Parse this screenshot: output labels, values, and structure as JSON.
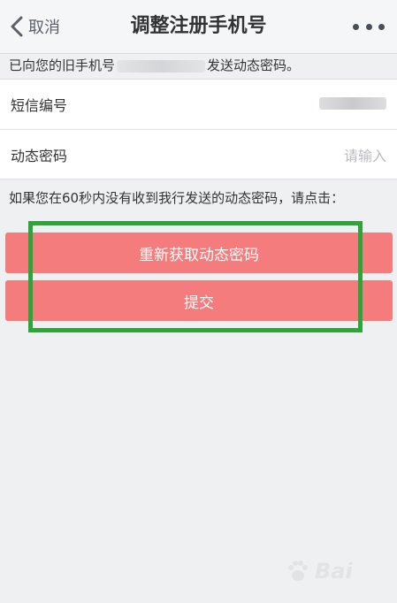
{
  "header": {
    "back_label": "取消",
    "title": "调整注册手机号"
  },
  "notice": {
    "prefix": "已向您的旧手机号",
    "suffix": "发送动态密码。"
  },
  "form": {
    "sms_label": "短信编号",
    "otp_label": "动态密码",
    "otp_placeholder": "请输入"
  },
  "hint": "如果您在60秒内没有收到我行发送的动态密码，请点击：",
  "buttons": {
    "resend_label": "重新获取动态密码",
    "submit_label": "提交"
  },
  "watermark": {
    "text": "Baidu 经验"
  },
  "colors": {
    "button": "#f47c7c",
    "highlight_box": "#2fa43a",
    "background": "#eff0f2"
  }
}
